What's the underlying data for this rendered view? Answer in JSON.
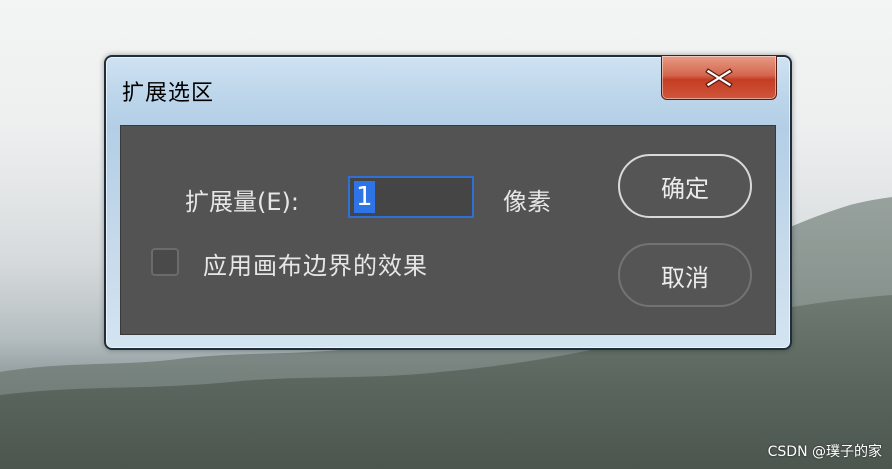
{
  "dialog": {
    "title": "扩展选区",
    "close_icon": "close-icon",
    "expand_label": "扩展量(E):",
    "expand_value": "1",
    "unit_label": "像素",
    "apply_canvas_bounds_label": "应用画布边界的效果",
    "apply_canvas_bounds_checked": false,
    "ok_label": "确定",
    "cancel_label": "取消",
    "colors": {
      "panel": "#535353",
      "close_button": "#c43d23",
      "selection_highlight": "#2e74e6"
    }
  },
  "watermark": "CSDN @璞子的家"
}
